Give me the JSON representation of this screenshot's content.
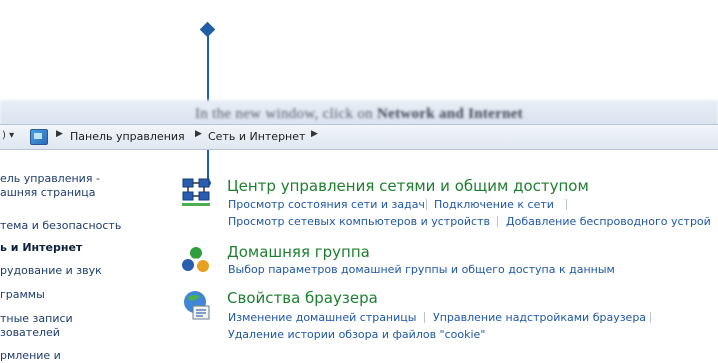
{
  "caption": {
    "prefix": "In the new window, click on",
    "bold": "Network and Internet"
  },
  "address_bar": {
    "nav_arrows": ") ▾",
    "crumb_1": "Панель управления",
    "crumb_2": "Сеть и Интернет",
    "separator": "▶"
  },
  "left_pane": {
    "items": [
      "ель управления -",
      "ашняя страница",
      "тема и безопасность",
      "ь и Интернет",
      "рудование и звук",
      "граммы",
      "тные записи",
      "зователей",
      "рмление и"
    ]
  },
  "categories": [
    {
      "title": "Центр управления сетями и общим доступом",
      "links": [
        "Просмотр состояния сети и задач",
        "Подключение к сети",
        "Просмотр сетевых компьютеров и устройств",
        "Добавление беспроводного устрой"
      ]
    },
    {
      "title": "Домашняя группа",
      "links": [
        "Выбор параметров домашней группы и общего доступа к данным"
      ]
    },
    {
      "title": "Свойства браузера",
      "links": [
        "Изменение домашней страницы",
        "Управление надстройками браузера",
        "Удаление истории обзора и файлов \"cookie\""
      ]
    }
  ],
  "colors": {
    "title_green": "#1d7f2f",
    "link_blue": "#1e57a8",
    "pointer_blue": "#1f5fa8"
  },
  "icons": [
    "network-sharing-icon",
    "homegroup-icon",
    "internet-options-icon"
  ]
}
